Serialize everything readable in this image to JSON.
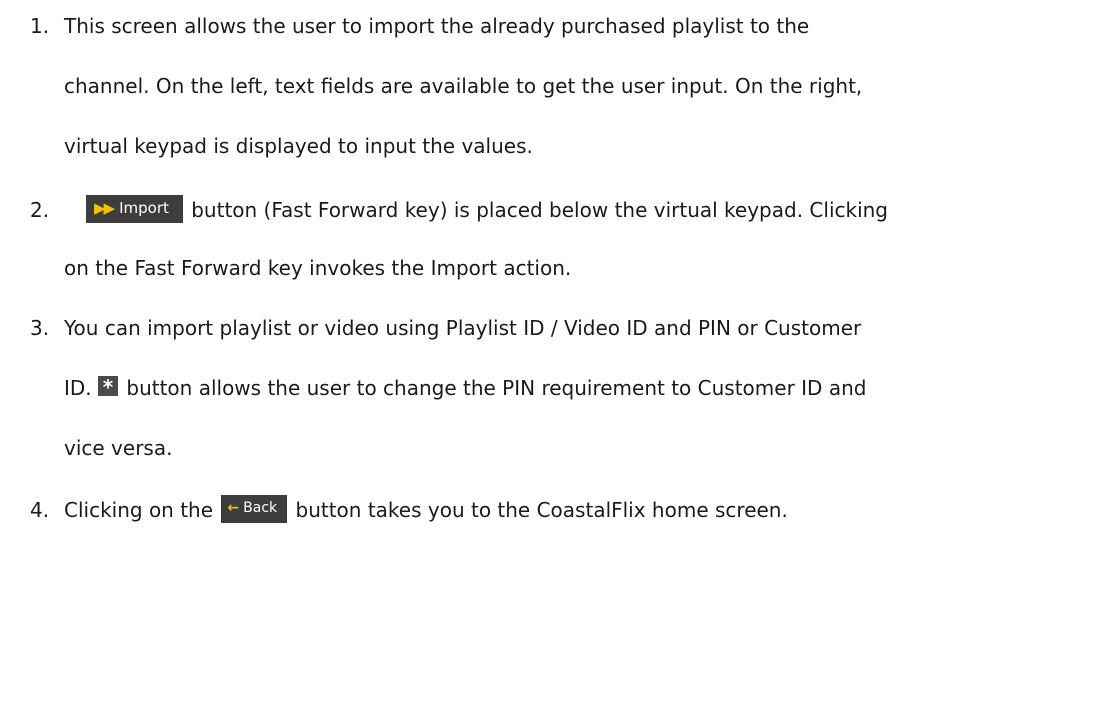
{
  "items": [
    {
      "number": "1.",
      "lines": [
        "This screen allows the user to import the already purchased playlist to the",
        "channel. On the left, text fields are available to get the user input. On the right,",
        "virtual keypad is displayed to input the values."
      ]
    },
    {
      "number": "2.",
      "button_label": "Import",
      "line1_after": "button (Fast Forward key) is placed below the virtual keypad. Clicking",
      "line2": "on the Fast Forward key invokes the Import action."
    },
    {
      "number": "3.",
      "line1": "You can import playlist or video using Playlist ID / Video ID and PIN or Customer",
      "line2_before": "ID.",
      "star_symbol": "*",
      "line2_after": "button allows the user to change the PIN requirement to Customer ID and",
      "line3": "vice versa."
    },
    {
      "number": "4.",
      "line_before": "Clicking on the",
      "button_label": "Back",
      "line_after": "button takes you to the CoastalFlix home screen."
    }
  ],
  "icons": {
    "fast_forward": "fast-forward-icon",
    "back_arrow": "left-arrow-icon",
    "accent_color": "#f2c200",
    "button_bg": "#3d3d3d"
  }
}
